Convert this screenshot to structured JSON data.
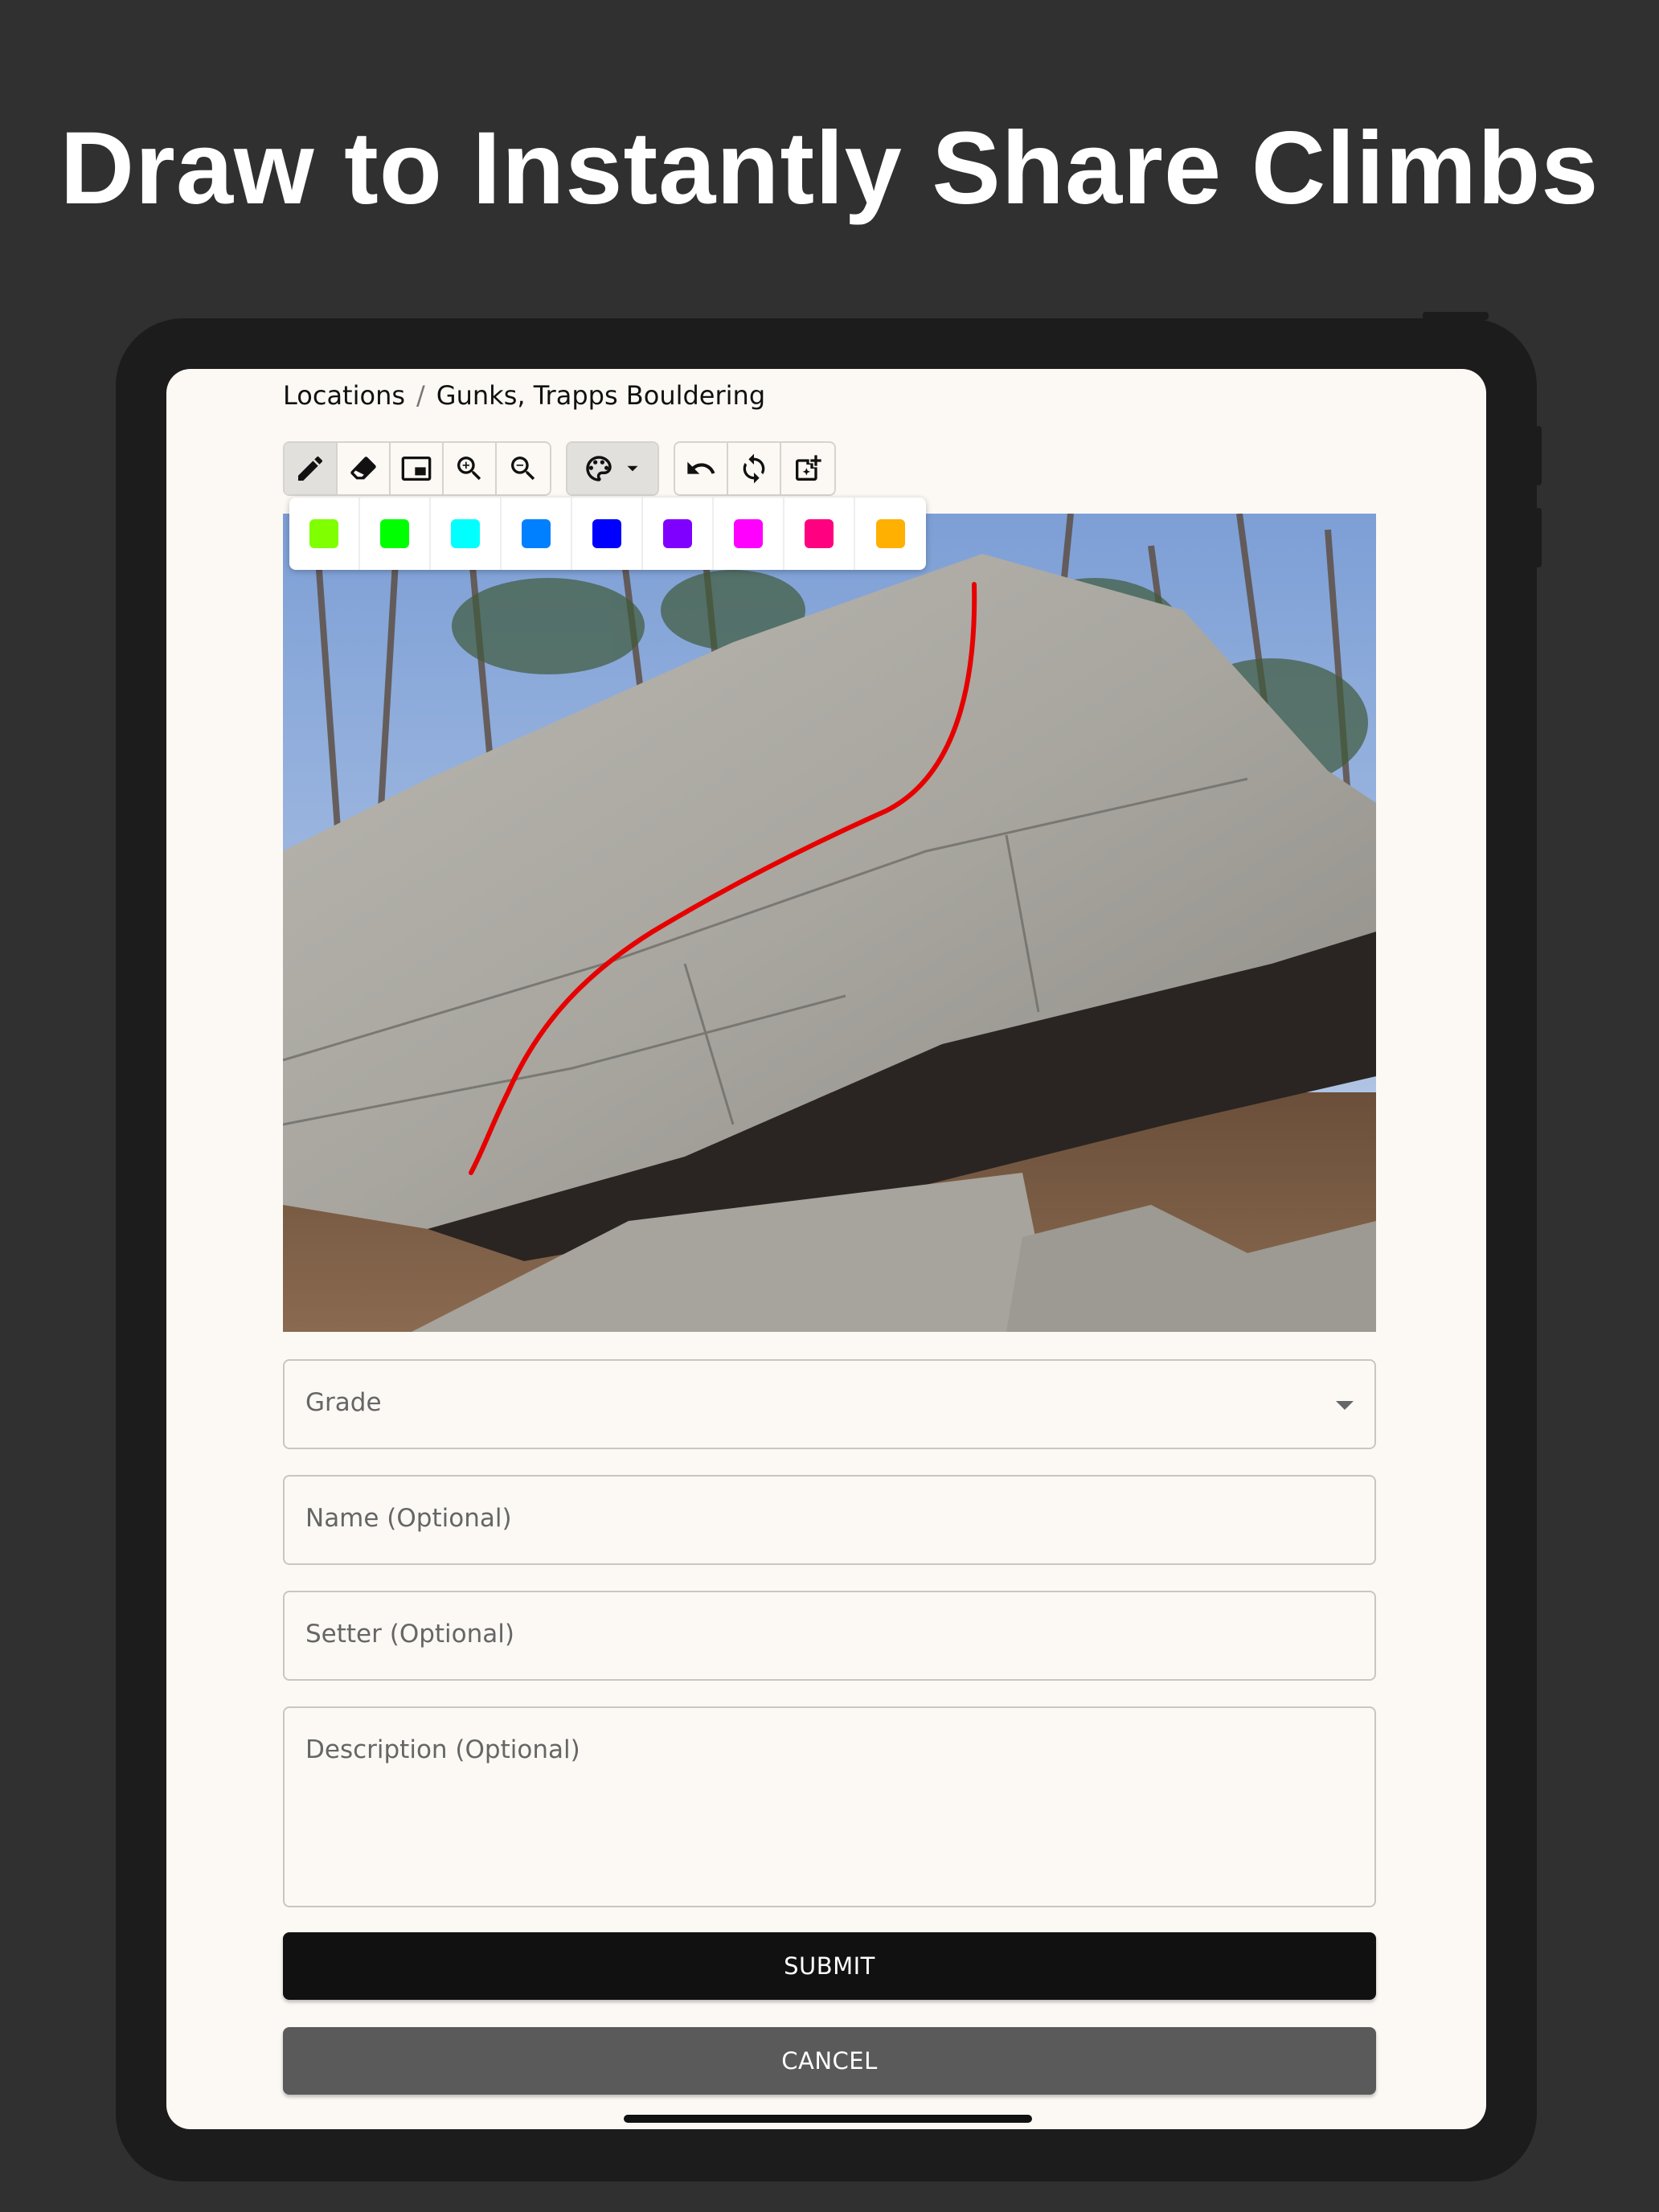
{
  "headline": "Draw to Instantly Share Climbs",
  "breadcrumb": {
    "root": "Locations",
    "separator": "/",
    "current": "Gunks, Trapps Bouldering"
  },
  "toolbar": {
    "draw_tools": [
      "pencil-icon",
      "eraser-icon",
      "picture-in-picture-icon",
      "zoom-in-icon",
      "zoom-out-icon"
    ],
    "active_tool": "pencil-icon",
    "palette": "palette-icon",
    "history_tools": [
      "undo-icon",
      "rotate-icon",
      "add-image-icon"
    ]
  },
  "swatches": [
    "#7fff00",
    "#00ff00",
    "#00ffff",
    "#0080ff",
    "#0000ff",
    "#8000ff",
    "#ff00ff",
    "#ff0080",
    "#ffb000"
  ],
  "route_line_color": "#e60000",
  "form": {
    "grade_placeholder": "Grade",
    "name_placeholder": "Name (Optional)",
    "setter_placeholder": "Setter (Optional)",
    "description_placeholder": "Description (Optional)"
  },
  "buttons": {
    "submit": "SUBMIT",
    "cancel": "CANCEL"
  },
  "colors": {
    "background": "#303030",
    "screen": "#fcf9f5",
    "submit_bg": "#111111",
    "cancel_bg": "#5a5a5a"
  }
}
